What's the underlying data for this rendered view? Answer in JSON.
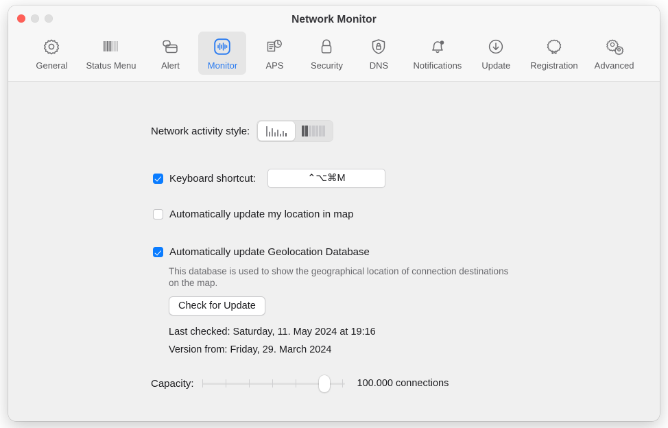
{
  "window": {
    "title": "Network Monitor",
    "traffic_lights": [
      "close",
      "minimize",
      "zoom"
    ]
  },
  "toolbar": {
    "tabs": [
      {
        "id": "general",
        "label": "General",
        "icon": "gear-icon",
        "selected": false
      },
      {
        "id": "status-menu",
        "label": "Status Menu",
        "icon": "barcode-icon",
        "selected": false
      },
      {
        "id": "alert",
        "label": "Alert",
        "icon": "window-alert-icon",
        "selected": false
      },
      {
        "id": "monitor",
        "label": "Monitor",
        "icon": "waveform-icon",
        "selected": true
      },
      {
        "id": "aps",
        "label": "APS",
        "icon": "document-sync-icon",
        "selected": false
      },
      {
        "id": "security",
        "label": "Security",
        "icon": "lock-icon",
        "selected": false
      },
      {
        "id": "dns",
        "label": "DNS",
        "icon": "shield-lock-icon",
        "selected": false
      },
      {
        "id": "notifications",
        "label": "Notifications",
        "icon": "bell-badge-icon",
        "selected": false
      },
      {
        "id": "update",
        "label": "Update",
        "icon": "download-circle-icon",
        "selected": false
      },
      {
        "id": "registration",
        "label": "Registration",
        "icon": "seal-icon",
        "selected": false
      },
      {
        "id": "advanced",
        "label": "Advanced",
        "icon": "gears-icon",
        "selected": false
      }
    ]
  },
  "main": {
    "activity_style": {
      "label": "Network activity style:",
      "options": [
        {
          "id": "bars",
          "icon": "activity-bars-icon",
          "selected": true
        },
        {
          "id": "meter",
          "icon": "activity-meter-icon",
          "selected": false
        }
      ]
    },
    "keyboard_shortcut": {
      "label": "Keyboard shortcut:",
      "checked": true,
      "value": "⌃⌥⌘M"
    },
    "auto_location": {
      "label": "Automatically update my location in map",
      "checked": false
    },
    "geolocation": {
      "label": "Automatically update Geolocation Database",
      "checked": true,
      "description": "This database is used to show the geographical location of connection destinations on the map.",
      "button_label": "Check for Update",
      "last_checked": "Last checked: Saturday, 11. May 2024 at 19:16",
      "version_from": "Version from: Friday, 29. March 2024"
    },
    "capacity": {
      "label": "Capacity:",
      "value_text": "100.000 connections",
      "ticks": 7,
      "knob_tick_index": 5
    }
  },
  "colors": {
    "accent": "#0a7cff",
    "selected_tab": "#2a7bf0",
    "toolbar_bg": "#f7f7f7",
    "content_bg": "#f0f0f0",
    "close_light": "#ff5f57"
  }
}
